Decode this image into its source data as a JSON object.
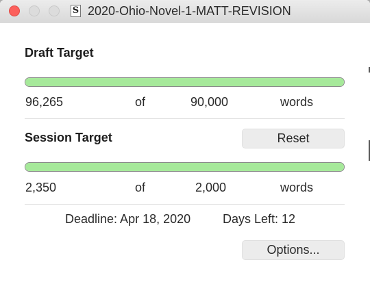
{
  "window": {
    "title": "2020-Ohio-Novel-1-MATT-REVISION",
    "doc_icon_glyph": "S"
  },
  "draft": {
    "label": "Draft Target",
    "progress": 1.0,
    "current": "96,265",
    "of": "of",
    "target": "90,000",
    "unit": "words"
  },
  "session": {
    "label": "Session Target",
    "reset_label": "Reset",
    "progress": 1.0,
    "current": "2,350",
    "of": "of",
    "target": "2,000",
    "unit": "words"
  },
  "deadline": {
    "text": "Deadline: Apr 18, 2020",
    "days_left": "Days Left: 12"
  },
  "options_label": "Options...",
  "colors": {
    "progress_fill": "#a6e99a",
    "close": "#fc605c"
  }
}
